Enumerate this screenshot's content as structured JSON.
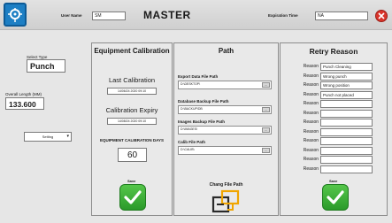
{
  "header": {
    "title": "MASTER",
    "username_label": "User Name",
    "username_value": "SM",
    "expiration_label": "Expiration Time",
    "expiration_value": "NA"
  },
  "left": {
    "select_type_label": "Select Type",
    "select_type_value": "Punch",
    "overall_length_label": "Overall Length (MM)",
    "overall_length_value": "133.600",
    "setting_value": "Setting"
  },
  "calibration": {
    "title": "Equipment Calibration",
    "last_label": "Last Calibration",
    "last_value": "14/06/24 2020 09:10",
    "expiry_label": "Calibration Expiry",
    "expiry_value": "14/08/24 2020 09:10",
    "days_label": "EQUIPMENT CALIBRATION DAYS",
    "days_value": "60",
    "save_label": "Save"
  },
  "path": {
    "title": "Path",
    "fields": [
      {
        "label": "Export Data File Path",
        "value": "D:\\DESKTOP\\",
        "browse": "..."
      },
      {
        "label": "Database Backup File Path",
        "value": "D:\\BACKUP\\DB",
        "browse": "..."
      },
      {
        "label": "Images Backup File Path",
        "value": "D:\\IMAGES\\",
        "browse": "..."
      },
      {
        "label": "Calib File Path",
        "value": "D:\\CALIB\\",
        "browse": "..."
      }
    ],
    "change_label": "Chang File Path"
  },
  "retry": {
    "title": "Retry Reason",
    "reason_label": "Reason",
    "reasons": [
      "Punch Cleaning",
      "Wrong punch",
      "Wrong position",
      "Punch not placed",
      "",
      "",
      "",
      "",
      "",
      "",
      "",
      ""
    ],
    "save_label": "Save"
  }
}
